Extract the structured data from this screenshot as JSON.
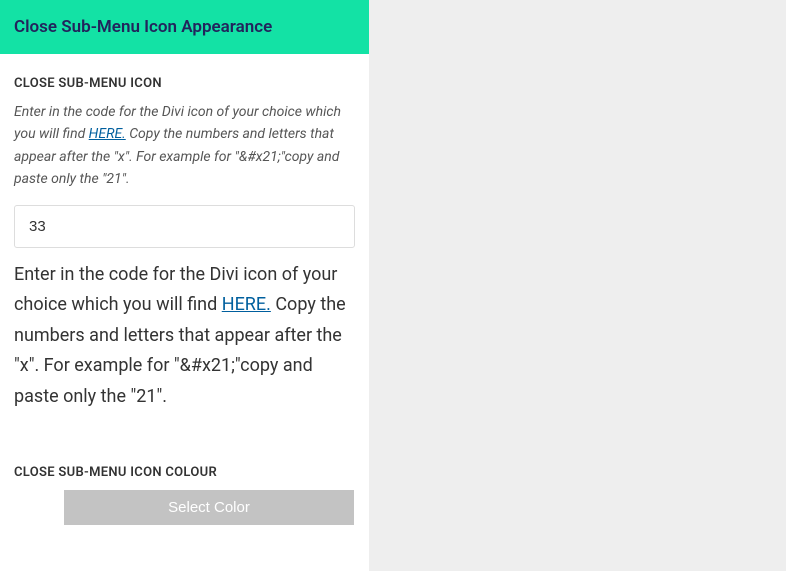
{
  "header": {
    "title": "Close Sub-Menu Icon Appearance"
  },
  "iconField": {
    "label": "CLOSE SUB-MENU ICON",
    "helpPrefix": "Enter in the code for the Divi icon of your choice which you will find ",
    "helpLink": "HERE.",
    "helpSuffix": " Copy the numbers and letters that appear after the \"x\". For example for \"&#x21;\"copy and paste only the \"21\".",
    "value": "33"
  },
  "bigHelp": {
    "prefix": "Enter in the code for the Divi icon of your choice which you will find ",
    "link": "HERE.",
    "suffix": " Copy the numbers and letters that appear after the \"x\". For example for \"&#x21;\"copy and paste only the \"21\"."
  },
  "colorField": {
    "label": "CLOSE SUB-MENU ICON COLOUR",
    "button": "Select Color"
  }
}
